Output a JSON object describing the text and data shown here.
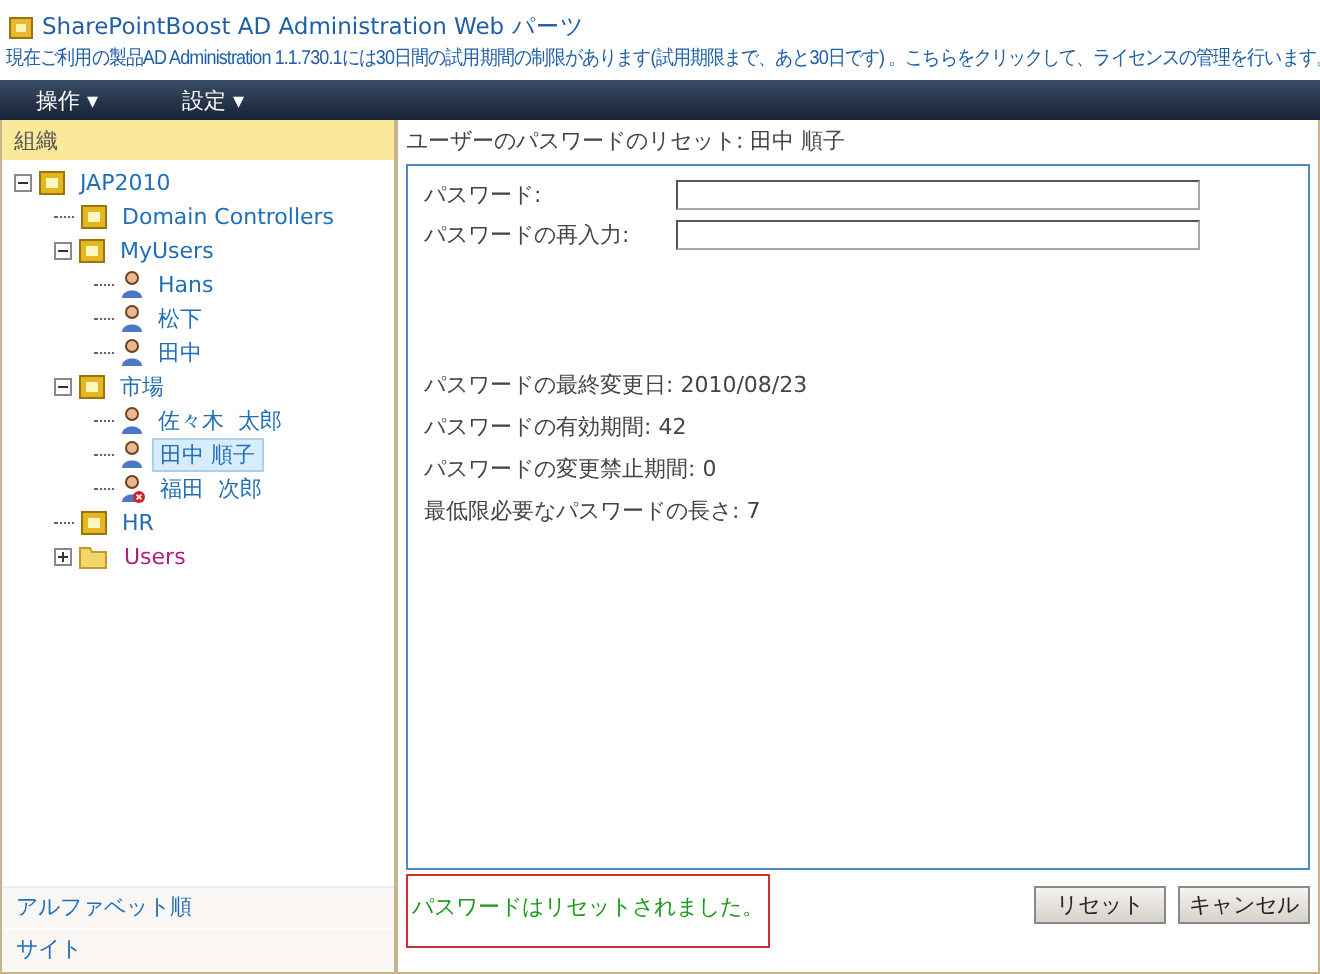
{
  "title": "SharePointBoost AD Administration Web パーツ",
  "notice": "現在ご利用の製品AD Administration 1.1.730.1には30日間の試用期間の制限があります(試用期限まで、あと30日です) 。こちらをクリックして、ライセンスの管理を行います。",
  "menu": [
    {
      "label": "操作 ▾"
    },
    {
      "label": "設定 ▾"
    }
  ],
  "sidebar": {
    "header": "組織",
    "tree": [
      {
        "label": "JAP2010",
        "kind": "domain",
        "expanded": true,
        "selected": false,
        "children": [
          {
            "label": "Domain Controllers",
            "kind": "folder",
            "selected": false
          },
          {
            "label": "MyUsers",
            "kind": "folder",
            "expanded": true,
            "selected": false,
            "children": [
              {
                "label": "Hans",
                "kind": "user",
                "selected": false
              },
              {
                "label": "松下",
                "kind": "user",
                "selected": false
              },
              {
                "label": "田中",
                "kind": "user",
                "selected": false
              }
            ]
          },
          {
            "label": "市場",
            "kind": "folder",
            "expanded": true,
            "selected": false,
            "children": [
              {
                "label": "佐々木  太郎",
                "kind": "user",
                "selected": false
              },
              {
                "label": "田中 順子",
                "kind": "user",
                "selected": true
              },
              {
                "label": "福田  次郎",
                "kind": "disabled-user",
                "selected": false
              }
            ]
          },
          {
            "label": "HR",
            "kind": "folder",
            "selected": false
          },
          {
            "label": "Users",
            "kind": "container",
            "expanded": false,
            "selected": false
          }
        ]
      }
    ],
    "footer_links": [
      {
        "label": "アルファベット順"
      },
      {
        "label": "サイト"
      }
    ]
  },
  "panel": {
    "heading": "ユーザーのパスワードのリセット:  田中 順子",
    "fields": [
      {
        "label": "パスワード:"
      },
      {
        "label": "パスワードの再入力:"
      }
    ],
    "info": [
      "パスワードの最終変更日: 2010/08/23",
      "パスワードの有効期間: 42",
      "パスワードの変更禁止期間: 0",
      "最低限必要なパスワードの長さ: 7"
    ],
    "message": "パスワードはリセットされました。",
    "buttons": [
      {
        "label": "リセット"
      },
      {
        "label": "キャンセル"
      }
    ]
  }
}
